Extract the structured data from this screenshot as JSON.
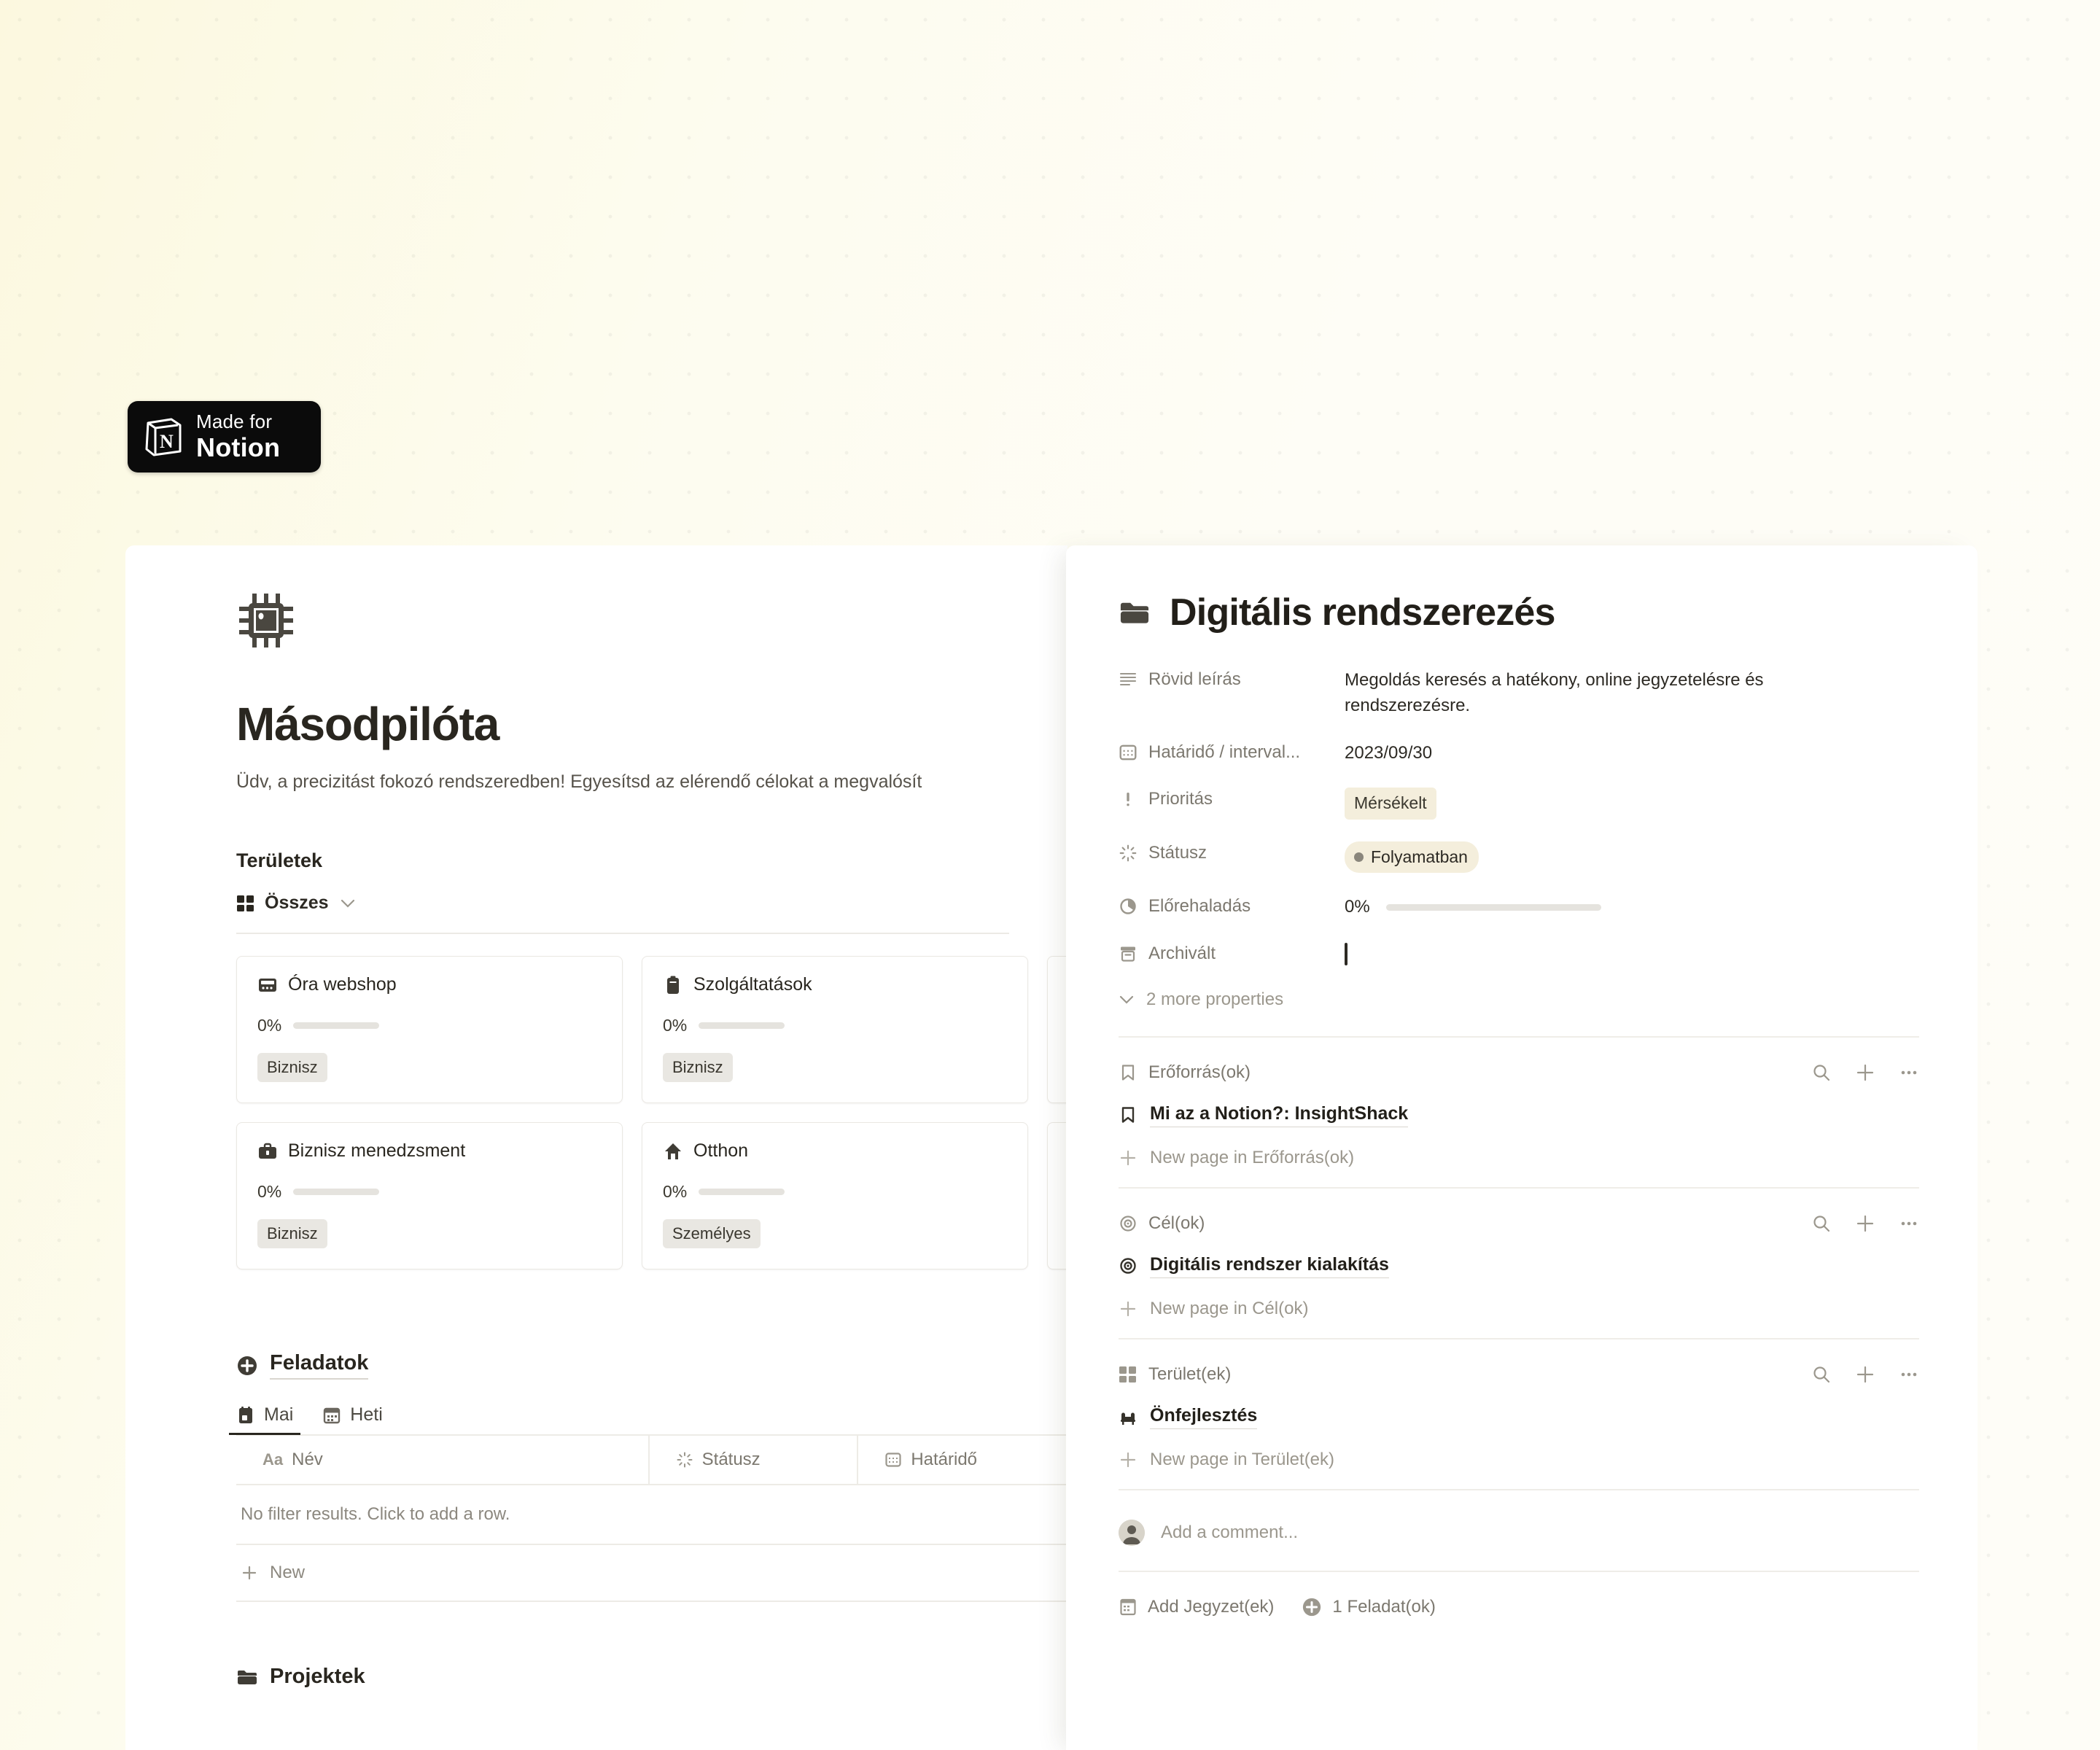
{
  "badge": {
    "line1": "Made for",
    "line2": "Notion",
    "logo_icon": "notion-logo-icon"
  },
  "left": {
    "icon": "cpu-chip-icon",
    "title": "Másodpilóta",
    "subtitle": "Üdv, a precizitást fokozó rendszeredben! Egyesítsd az elérendő célokat a megvalósít",
    "areas": {
      "heading": "Területek",
      "view_label": "Összes",
      "view_icon": "gallery-view-icon",
      "chevron_icon": "chevron-down-icon",
      "cards": [
        {
          "icon": "calculator-icon",
          "title": "Óra webshop",
          "progress": "0%",
          "tag": "Biznisz"
        },
        {
          "icon": "clipboard-icon",
          "title": "Szolgáltatások",
          "progress": "0%",
          "tag": "Biznisz"
        },
        {
          "icon": "briefcase-icon",
          "title": "Biznisz menedzsment",
          "progress": "0%",
          "tag": "Biznisz"
        },
        {
          "icon": "home-icon",
          "title": "Otthon",
          "progress": "0%",
          "tag": "Személyes"
        }
      ]
    },
    "tasks": {
      "heading": "Feladatok",
      "heading_icon": "plus-circle-icon",
      "tabs": [
        {
          "label": "Mai",
          "icon": "calendar-day-icon",
          "active": true
        },
        {
          "label": "Heti",
          "icon": "calendar-week-icon",
          "active": false
        }
      ],
      "columns": [
        {
          "label": "Név",
          "icon": "text-aa-icon"
        },
        {
          "label": "Státusz",
          "icon": "status-spinner-icon"
        },
        {
          "label": "Határidő",
          "icon": "calendar-icon"
        }
      ],
      "empty_text": "No filter results. Click to add a row.",
      "new_row_label": "New",
      "new_row_icon": "plus-icon"
    },
    "projects": {
      "label": "Projektek",
      "icon": "folder-icon"
    }
  },
  "right": {
    "icon": "folder-icon",
    "title": "Digitális rendszerezés",
    "properties": [
      {
        "icon": "text-lines-icon",
        "label": "Rövid leírás",
        "value": "Megoldás keresés a hatékony, online jegyzetelésre és rendszerezésre.",
        "type": "text"
      },
      {
        "icon": "calendar-icon",
        "label": "Határidő / interval...",
        "value": "2023/09/30",
        "type": "text"
      },
      {
        "icon": "exclamation-icon",
        "label": "Prioritás",
        "value": "Mérsékelt",
        "type": "tag"
      },
      {
        "icon": "status-spinner-icon",
        "label": "Státusz",
        "value": "Folyamatban",
        "type": "status"
      },
      {
        "icon": "progress-pie-icon",
        "label": "Előrehaladás",
        "value": "0%",
        "type": "progress"
      },
      {
        "icon": "archive-icon",
        "label": "Archivált",
        "value": "",
        "type": "checkbox"
      }
    ],
    "more_properties_label": "2 more properties",
    "more_properties_icon": "chevron-down-icon",
    "relations": [
      {
        "icon": "bookmark-icon",
        "label": "Erőforrás(ok)",
        "actions": [
          "search-icon",
          "plus-icon",
          "ellipsis-icon"
        ],
        "items": [
          {
            "icon": "bookmark-icon",
            "label": "Mi az a Notion?: InsightShack"
          }
        ],
        "new_label": "New page in Erőforrás(ok)",
        "new_icon": "plus-icon"
      },
      {
        "icon": "target-icon",
        "label": "Cél(ok)",
        "actions": [
          "search-icon",
          "plus-icon",
          "ellipsis-icon"
        ],
        "items": [
          {
            "icon": "target-icon",
            "label": "Digitális rendszer kialakítás"
          }
        ],
        "new_label": "New page in Cél(ok)",
        "new_icon": "plus-icon"
      },
      {
        "icon": "gallery-view-icon",
        "label": "Terület(ek)",
        "actions": [
          "search-icon",
          "plus-icon",
          "ellipsis-icon"
        ],
        "items": [
          {
            "icon": "armchair-icon",
            "label": "Önfejlesztés"
          }
        ],
        "new_label": "New page in Terület(ek)",
        "new_icon": "plus-icon"
      }
    ],
    "comment": {
      "placeholder": "Add a comment...",
      "avatar_icon": "user-avatar-icon"
    },
    "footer": [
      {
        "icon": "note-icon",
        "label": "Add Jegyzet(ek)"
      },
      {
        "icon": "plus-circle-icon",
        "label": "1 Feladat(ok)"
      }
    ]
  },
  "colors": {
    "canvas": "#FDFBEB",
    "panel": "#FFFFFF",
    "text": "#29261F",
    "muted": "#7C786F",
    "tag_bg": "#E9E7E2",
    "status_bg": "#F4EEDC"
  }
}
